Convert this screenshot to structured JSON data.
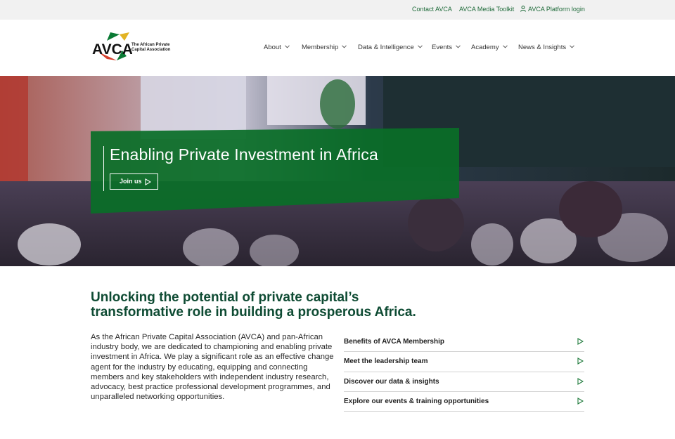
{
  "topbar": {
    "contact": "Contact AVCA",
    "toolkit": "AVCA Media Toolkit",
    "platform": "AVCA Platform login"
  },
  "logo": {
    "wordmark": "AVCA",
    "tagline_1": "The African Private",
    "tagline_2": "Capital Association"
  },
  "nav": {
    "about": "About",
    "membership": "Membership",
    "data": "Data & Intelligence",
    "events": "Events",
    "academy": "Academy",
    "news": "News & Insights"
  },
  "hero": {
    "title": "Enabling Private Investment in Africa",
    "cta": "Join us"
  },
  "content": {
    "headline": "Unlocking the potential of private capital’s transformative role in building a prosperous Africa.",
    "intro": "As the African Private Capital Association (AVCA) and pan-African industry body, we are dedicated to championing and enabling private investment in Africa. We play a significant role as an effective change agent for the industry by educating, equipping and connecting members and key stakeholders with independent industry research, advocacy, best practice professional development programmes, and unparalleled networking opportunities."
  },
  "quick_links": [
    {
      "label": "Benefits of AVCA Membership"
    },
    {
      "label": "Meet the leadership team"
    },
    {
      "label": "Discover our data & insights"
    },
    {
      "label": "Explore our events & training opportunities"
    }
  ],
  "colors": {
    "brand_green": "#0a6e28",
    "headline_green": "#0e4b33",
    "topbar_bg": "#f1f1f1"
  }
}
